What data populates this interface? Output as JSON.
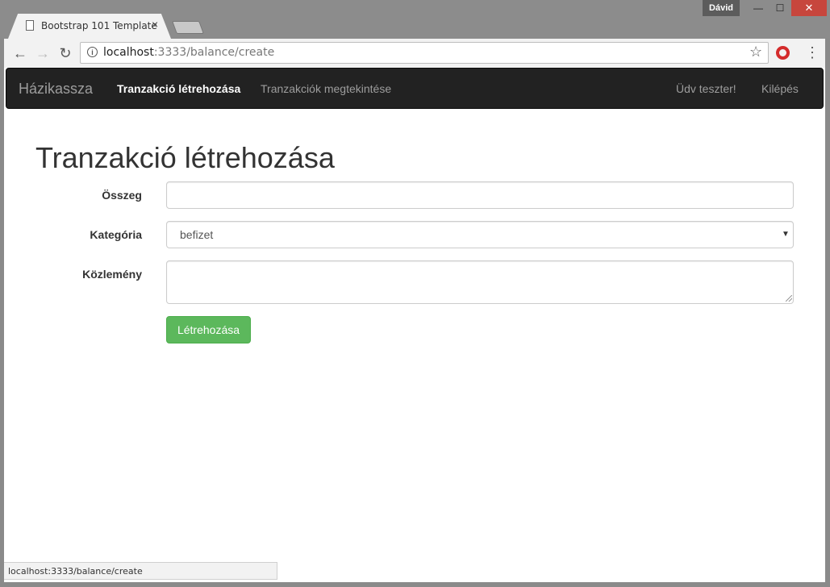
{
  "window": {
    "profile_name": "Dávid",
    "minimize": "—",
    "maximize": "☐",
    "close": "✕"
  },
  "tab": {
    "title": "Bootstrap 101 Template",
    "close": "×"
  },
  "browser": {
    "back": "←",
    "forward": "→",
    "reload": "↻",
    "info": "i",
    "url_host": "localhost",
    "url_path": ":3333/balance/create",
    "star": "☆",
    "menu": "⋮"
  },
  "navbar": {
    "brand": "Házikassza",
    "items": [
      {
        "label": "Tranzakció létrehozása",
        "active": true
      },
      {
        "label": "Tranzakciók megtekintése",
        "active": false
      }
    ],
    "right": [
      {
        "label": "Üdv teszter!"
      },
      {
        "label": "Kilépés"
      }
    ]
  },
  "main": {
    "title": "Tranzakció létrehozása",
    "form": {
      "amount_label": "Összeg",
      "amount_value": "",
      "category_label": "Kategória",
      "category_value": "befizet",
      "note_label": "Közlemény",
      "note_value": "",
      "submit": "Létrehozása"
    }
  },
  "status_bar": {
    "text": "localhost:3333/balance/create"
  },
  "colors": {
    "navbar_bg": "#222222",
    "success": "#5cb85c",
    "close_btn": "#c7463d"
  }
}
